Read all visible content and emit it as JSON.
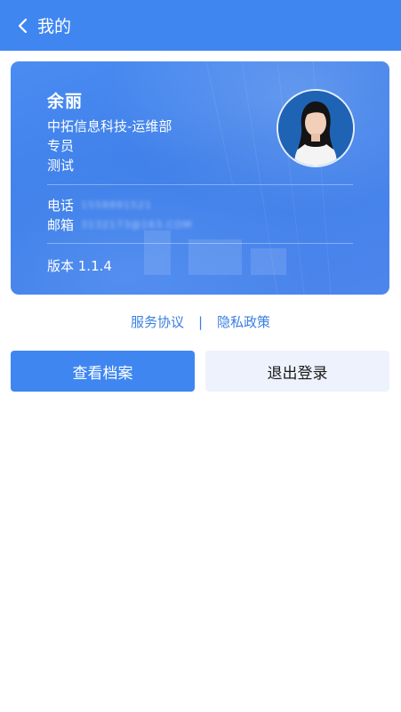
{
  "header": {
    "back_icon": "chevron-left-icon",
    "title": "我的"
  },
  "profile": {
    "name": "余丽",
    "company_dept": "中拓信息科技-运维部",
    "position": "专员",
    "tag": "测试",
    "phone_label": "电话",
    "phone_value": "1558891521",
    "email_label": "邮箱",
    "email_value": "3132173@163.COM",
    "version": "版本 1.1.4"
  },
  "links": {
    "service_agreement": "服务协议",
    "separator": "|",
    "privacy_policy": "隐私政策"
  },
  "actions": {
    "view_profile": "查看档案",
    "logout": "退出登录"
  },
  "colors": {
    "primary": "#3f86f1",
    "link": "#3a7fe0",
    "secondary_button_bg": "#eef2fc"
  }
}
